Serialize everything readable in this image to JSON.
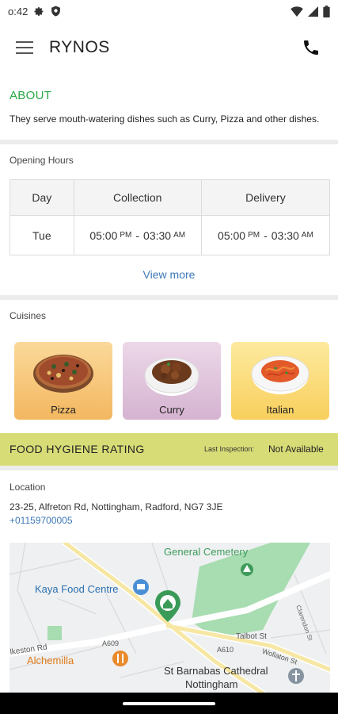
{
  "status_bar": {
    "time": "o:42"
  },
  "app_bar": {
    "title": "RYNOS"
  },
  "about": {
    "heading": "ABOUT",
    "text": "They serve mouth-watering dishes such as Curry, Pizza and other dishes."
  },
  "opening_hours": {
    "label": "Opening Hours",
    "headers": [
      "Day",
      "Collection",
      "Delivery"
    ],
    "row": {
      "day": "Tue",
      "collection": {
        "start": "05:00",
        "start_ampm": "PM",
        "sep": "-",
        "end": "03:30",
        "end_ampm": "AM"
      },
      "delivery": {
        "start": "05:00",
        "start_ampm": "PM",
        "sep": "-",
        "end": "03:30",
        "end_ampm": "AM"
      }
    },
    "view_more": "View more"
  },
  "cuisines": {
    "label": "Cuisines",
    "items": [
      {
        "name": "Pizza",
        "color": "#f6c97a"
      },
      {
        "name": "Curry",
        "color": "#e2c6dd"
      },
      {
        "name": "Italian",
        "color": "#fbe08a"
      }
    ]
  },
  "hygiene": {
    "title": "FOOD HYGIENE RATING",
    "last_inspection_label": "Last Inspection:",
    "value": "Not Available",
    "color": "#d7dc77"
  },
  "location": {
    "label": "Location",
    "address": "23-25, Alfreton Rd, Nottingham, Radford, NG7 3JE",
    "phone": "+01159700005"
  },
  "map": {
    "labels": {
      "cemetery": "General Cemetery",
      "kaya": "Kaya Food Centre",
      "ilkeston": "Ilkeston Rd",
      "a609": "A609",
      "a610": "A610",
      "alchemilla": "Alchemilla",
      "talbot": "Talbot St",
      "wollaton": "Wollaton St",
      "clarendon": "Clarendon St",
      "barnabas1": "St Barnabas Cathedral",
      "barnabas2": "Nottingham"
    }
  },
  "colors": {
    "accent_green": "#27a745",
    "link_blue": "#3d79b8"
  }
}
